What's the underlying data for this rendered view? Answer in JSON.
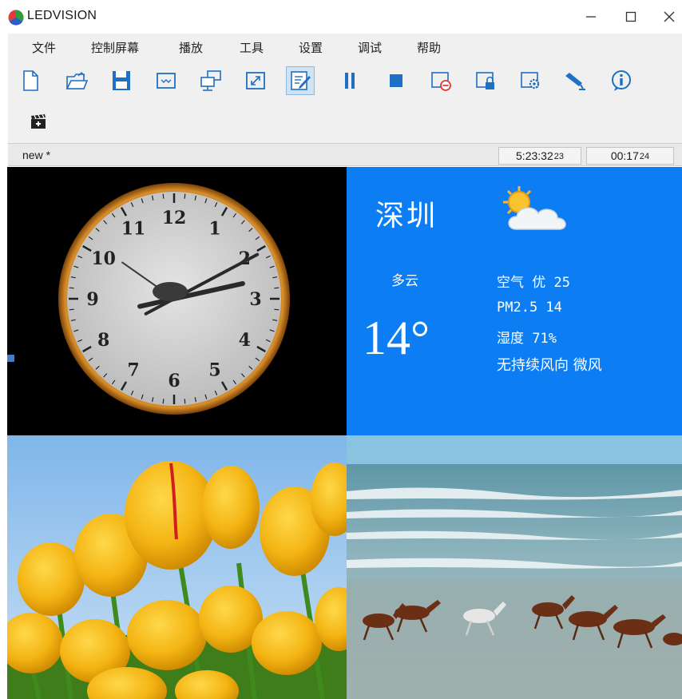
{
  "window": {
    "title": "LEDVISION",
    "minimize_icon": "minimize-icon",
    "maximize_icon": "maximize-icon",
    "close_icon": "close-icon"
  },
  "menu": [
    "文件",
    "控制屏幕",
    "播放",
    "工具",
    "设置",
    "调试",
    "帮助"
  ],
  "toolbar": {
    "buttons": [
      {
        "icon": "new-file-icon"
      },
      {
        "icon": "open-folder-icon"
      },
      {
        "icon": "save-icon"
      },
      {
        "icon": "display-icon"
      },
      {
        "icon": "network-screens-icon"
      },
      {
        "icon": "fullscreen-icon"
      },
      {
        "icon": "edit-icon",
        "active": true
      },
      {
        "icon": "pause-icon"
      },
      {
        "icon": "stop-icon"
      },
      {
        "icon": "screen-off-icon"
      },
      {
        "icon": "lock-icon"
      },
      {
        "icon": "screen-settings-icon"
      },
      {
        "icon": "camera-icon"
      },
      {
        "icon": "info-icon"
      }
    ],
    "secondary": [
      {
        "icon": "add-program-clapper-icon"
      }
    ]
  },
  "status": {
    "document_tab": "new *",
    "clock_time": "5:23:32",
    "clock_frames": "23",
    "elapsed_time": "00:17",
    "elapsed_frames": "24"
  },
  "clock": {
    "numerals": [
      "12",
      "1",
      "2",
      "3",
      "4",
      "5",
      "6",
      "7",
      "8",
      "9",
      "10",
      "11"
    ],
    "hour": 2,
    "minute": 11
  },
  "weather": {
    "city": "深圳",
    "condition": "多云",
    "temperature": "14°",
    "air_quality": "空气 优 25",
    "pm25": "PM2.5 14",
    "humidity": "湿度 71%",
    "wind": "无持续风向 微风",
    "icon": "partly-cloudy-icon"
  },
  "colors": {
    "accent": "#0c7df2",
    "toolbar_icon": "#1f6fc2",
    "menu_bg": "#f0f0f0"
  },
  "images": {
    "tulips": "tulip-flowers-image",
    "horses": "horses-beach-image"
  }
}
